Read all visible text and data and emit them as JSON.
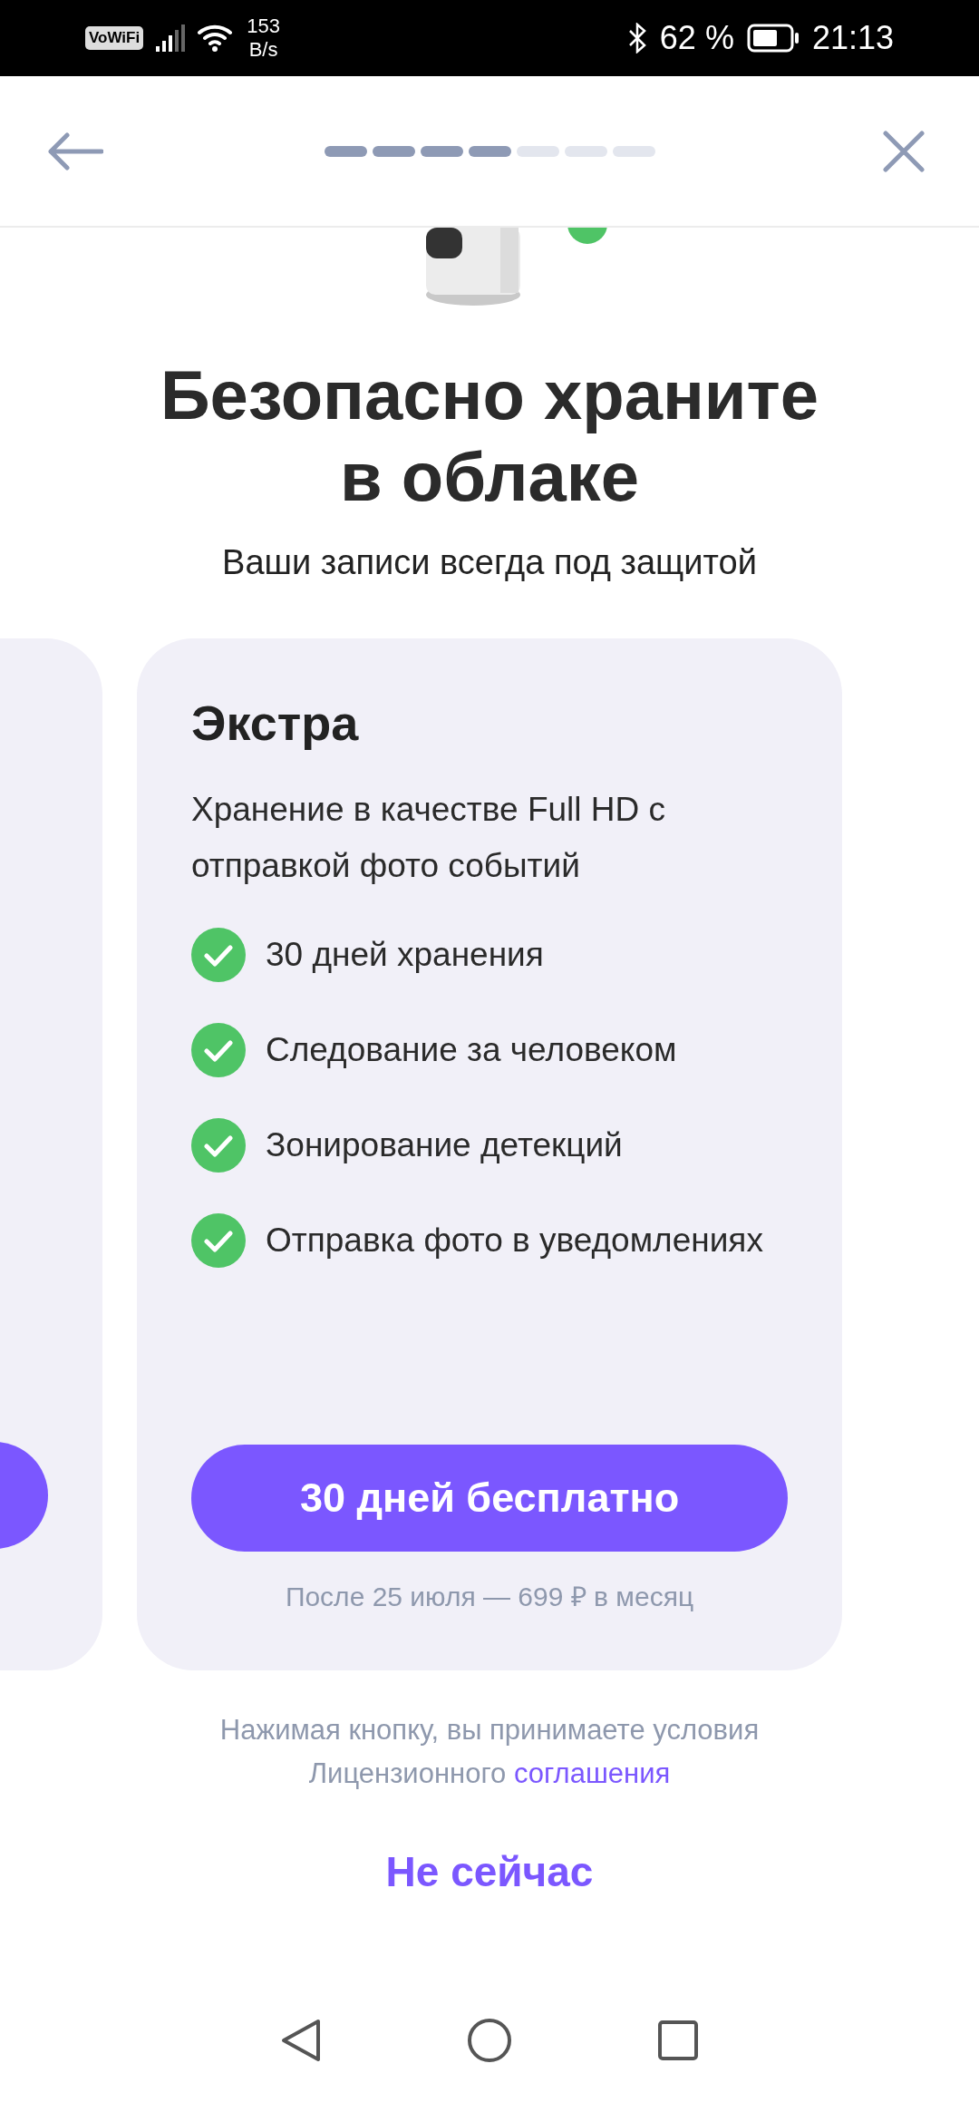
{
  "status_bar": {
    "wifi_badge": "VoWiFi",
    "speed_value": "153",
    "speed_unit": "B/s",
    "battery": "62 %",
    "time": "21:13"
  },
  "progress": {
    "steps": [
      {
        "done": true
      },
      {
        "done": true
      },
      {
        "done": true
      },
      {
        "done": true
      },
      {
        "done": false
      },
      {
        "done": false
      },
      {
        "done": false
      }
    ]
  },
  "title": "Безопасно храните в облаке",
  "subtitle": "Ваши записи всегда под защитой",
  "plans": [
    {
      "partial": true
    },
    {
      "partial": false,
      "name": "Экстра",
      "description": "Хранение в качестве Full HD с отправкой фото событий",
      "features": [
        "30 дней хранения",
        "Следование за человеком",
        "Зонирование детекций",
        "Отправка фото в уведомлениях"
      ],
      "button": "30 дней бесплатно",
      "price_note": "После 25 июля — 699 ₽ в месяц"
    }
  ],
  "legal": {
    "text": "Нажимая кнопку, вы принимаете условия Лицензионного",
    "link": "соглашения"
  },
  "skip_button": "Не сейчас"
}
